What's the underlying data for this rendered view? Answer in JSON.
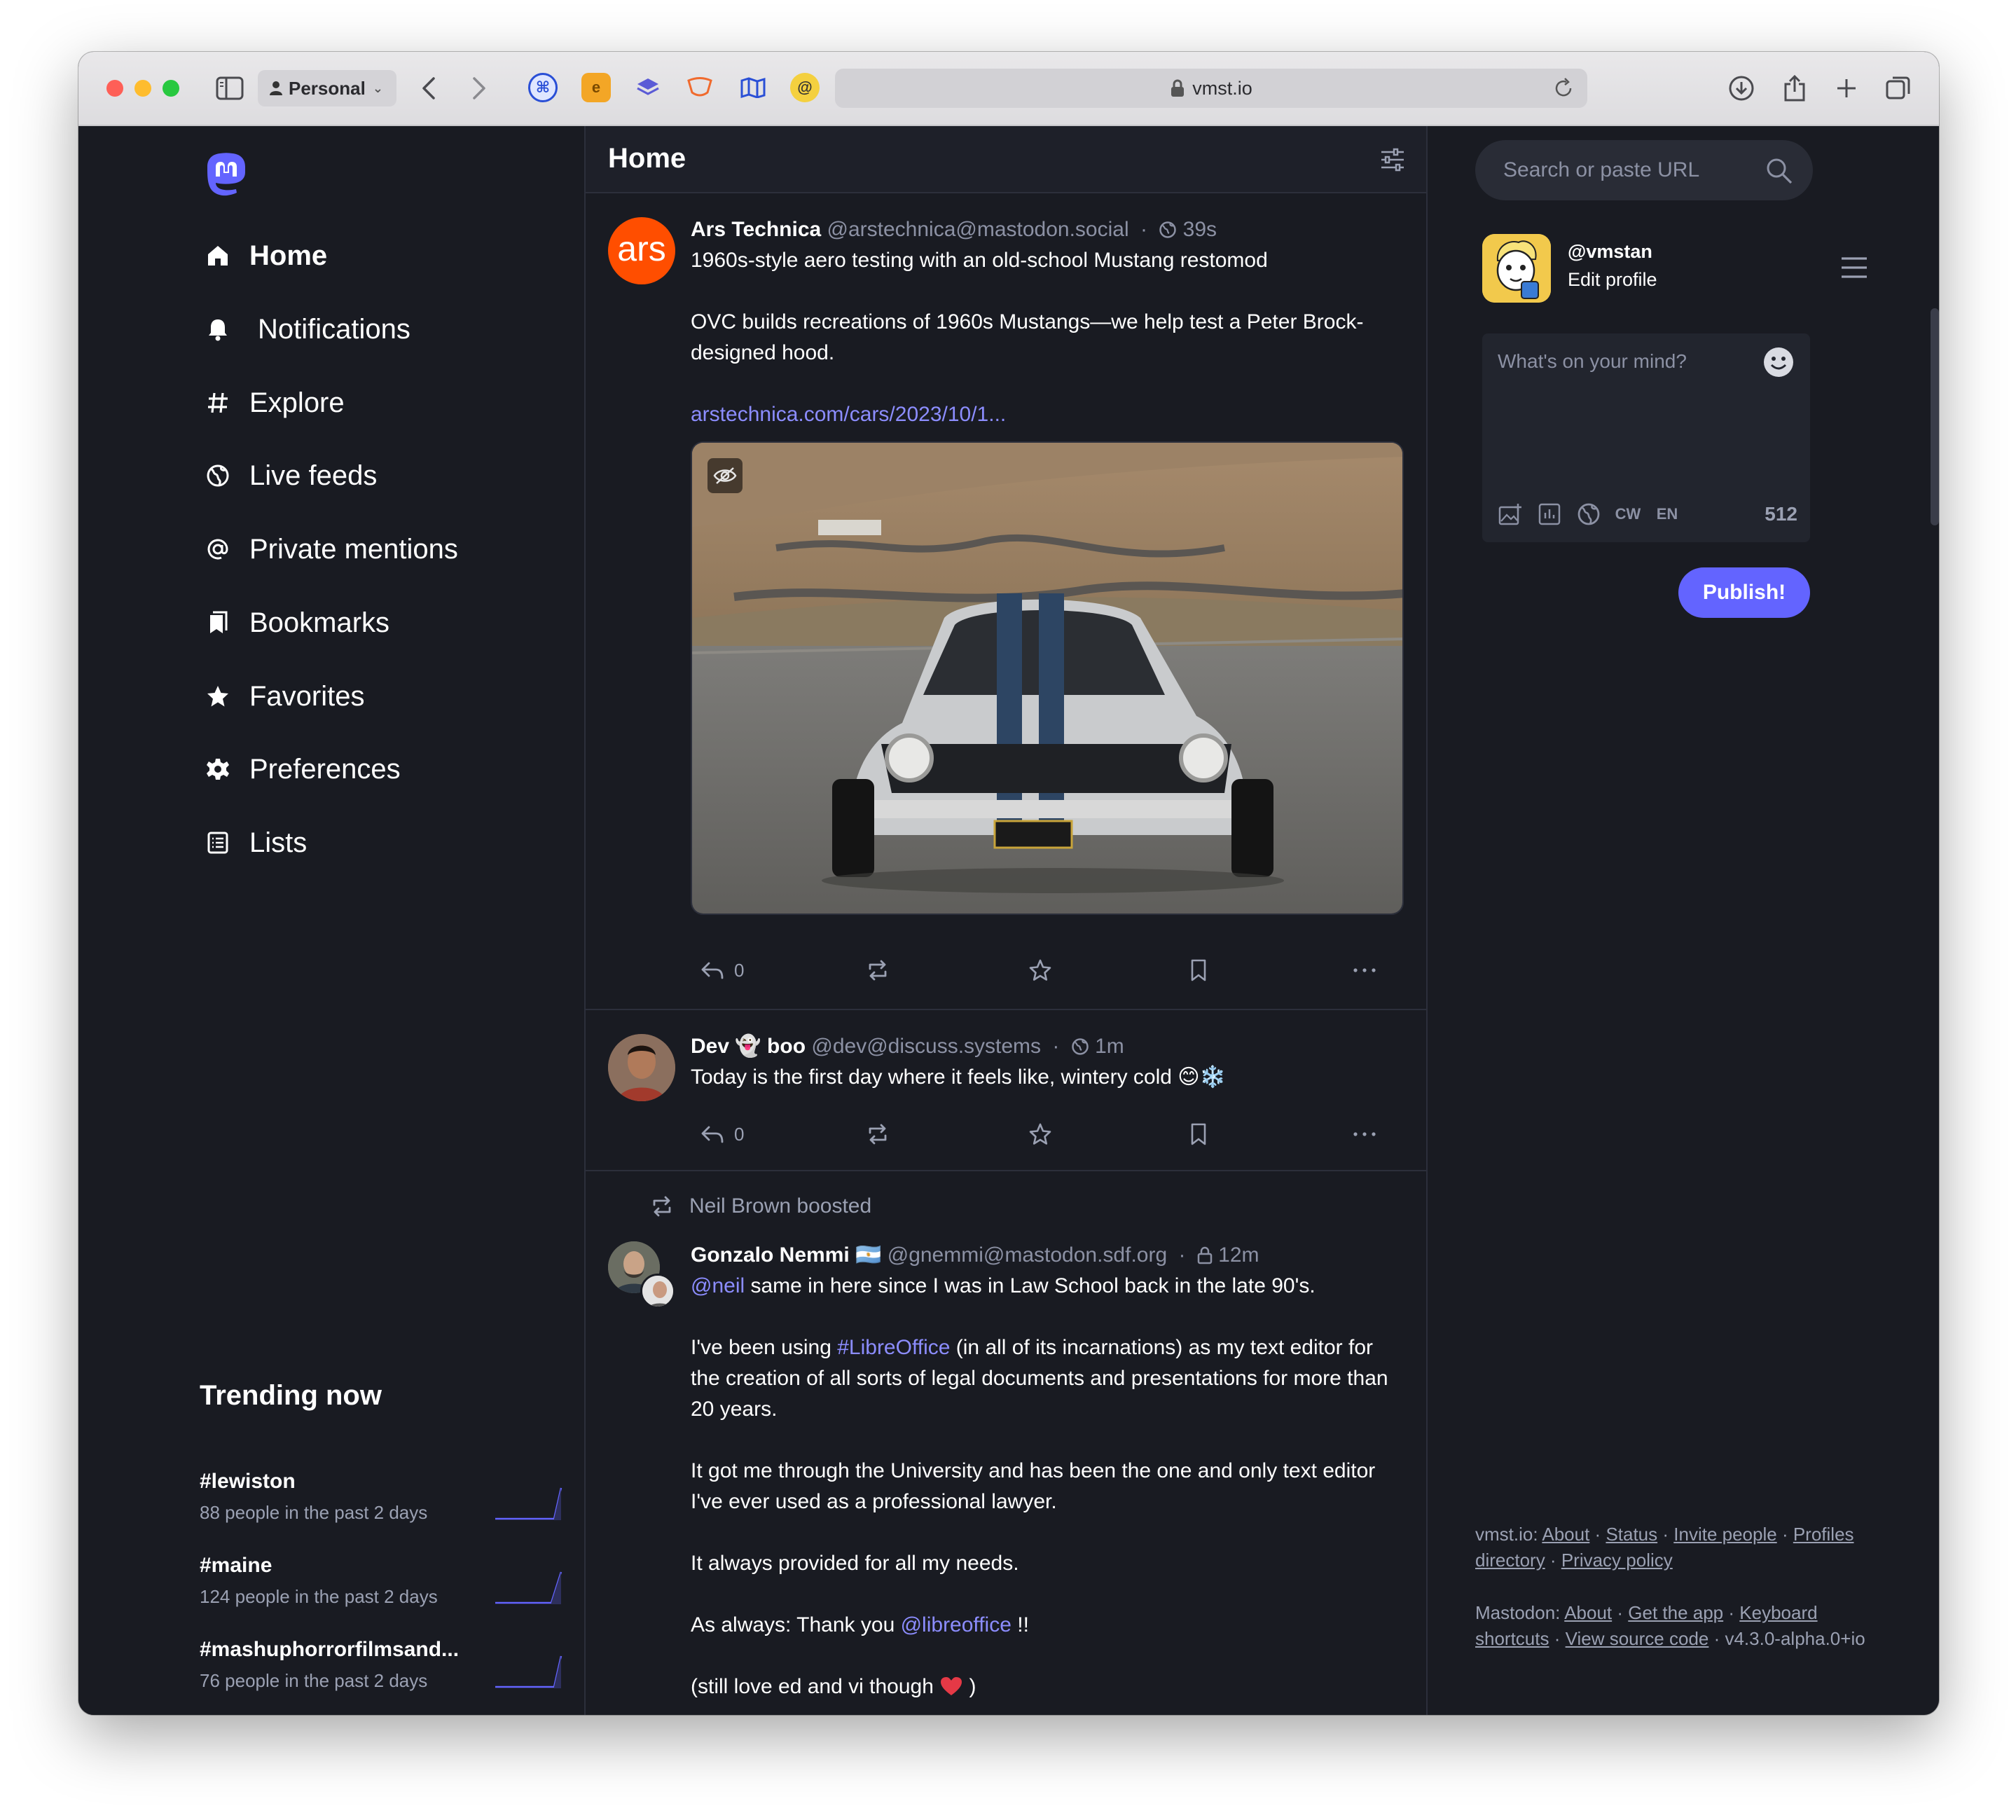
{
  "browser": {
    "profile": "Personal",
    "url": "vmst.io"
  },
  "nav": {
    "items": [
      {
        "label": "Home",
        "icon": "home-icon"
      },
      {
        "label": "Notifications",
        "icon": "bell-icon"
      },
      {
        "label": "Explore",
        "icon": "hash-icon"
      },
      {
        "label": "Live feeds",
        "icon": "globe-icon"
      },
      {
        "label": "Private mentions",
        "icon": "at-icon"
      },
      {
        "label": "Bookmarks",
        "icon": "bookmarks-icon"
      },
      {
        "label": "Favorites",
        "icon": "star-icon"
      },
      {
        "label": "Preferences",
        "icon": "gear-icon"
      },
      {
        "label": "Lists",
        "icon": "list-icon"
      }
    ]
  },
  "trending": {
    "title": "Trending now",
    "items": [
      {
        "tag": "#lewiston",
        "meta": "88 people in the past 2 days"
      },
      {
        "tag": "#maine",
        "meta": "124 people in the past 2 days"
      },
      {
        "tag": "#mashuphorrorfilmsand...",
        "meta": "76 people in the past 2 days"
      }
    ]
  },
  "column": {
    "title": "Home"
  },
  "statuses": [
    {
      "display_name": "Ars Technica",
      "acct": "@arstechnica@mastodon.social",
      "time": "39s",
      "avatar_text": "ars",
      "title": "1960s-style aero testing with an old-school Mustang restomod",
      "summary": "OVC builds recreations of 1960s Mustangs—we help test a Peter Brock-designed hood.",
      "link": "arstechnica.com/cars/2023/10/1...",
      "replies": "0"
    },
    {
      "display_name": "Dev 👻 boo",
      "acct": "@dev@discuss.systems",
      "time": "1m",
      "text": "Today is the first day where it feels like, wintery cold 😊❄️",
      "replies": "0"
    },
    {
      "boosted_by": "Neil Brown boosted",
      "display_name": "Gonzalo Nemmi 🇦🇷",
      "acct": "@gnemmi@mastodon.sdf.org",
      "time": "12m",
      "mention": "@neil",
      "line1": " same in here since I was in Law School back in the late 90's.",
      "p2_start": "I've been using ",
      "hashtag": "#LibreOffice",
      "p2_end": " (in all of its incarnations) as my text editor for the creation of all sorts of legal documents and presentations for more than 20 years.",
      "p3": "It got me through the University and has been the one and only text editor I've ever used as a professional lawyer.",
      "p4": "It always provided for all my needs.",
      "p5_start": "As always: Thank you ",
      "p5_mention": "@libreoffice",
      "p5_end": " !!",
      "p6_start": "(still love ed and vi though ",
      "p6_end": " )"
    }
  ],
  "right": {
    "search_placeholder": "Search or paste URL",
    "handle": "@vmstan",
    "edit_profile": "Edit profile",
    "compose_placeholder": "What's on your mind?",
    "cw": "CW",
    "lang": "EN",
    "char_count": "512",
    "publish": "Publish!"
  },
  "footer": {
    "server": "vmst.io:",
    "links1": [
      "About",
      "Status",
      "Invite people",
      "Profiles directory",
      "Privacy policy"
    ],
    "mastodon": "Mastodon:",
    "links2": [
      "About",
      "Get the app",
      "Keyboard shortcuts",
      "View source code"
    ],
    "version": "v4.3.0-alpha.0+io"
  },
  "colors": {
    "accent": "#6364ff",
    "link": "#8c8dff",
    "background": "#191b22"
  }
}
